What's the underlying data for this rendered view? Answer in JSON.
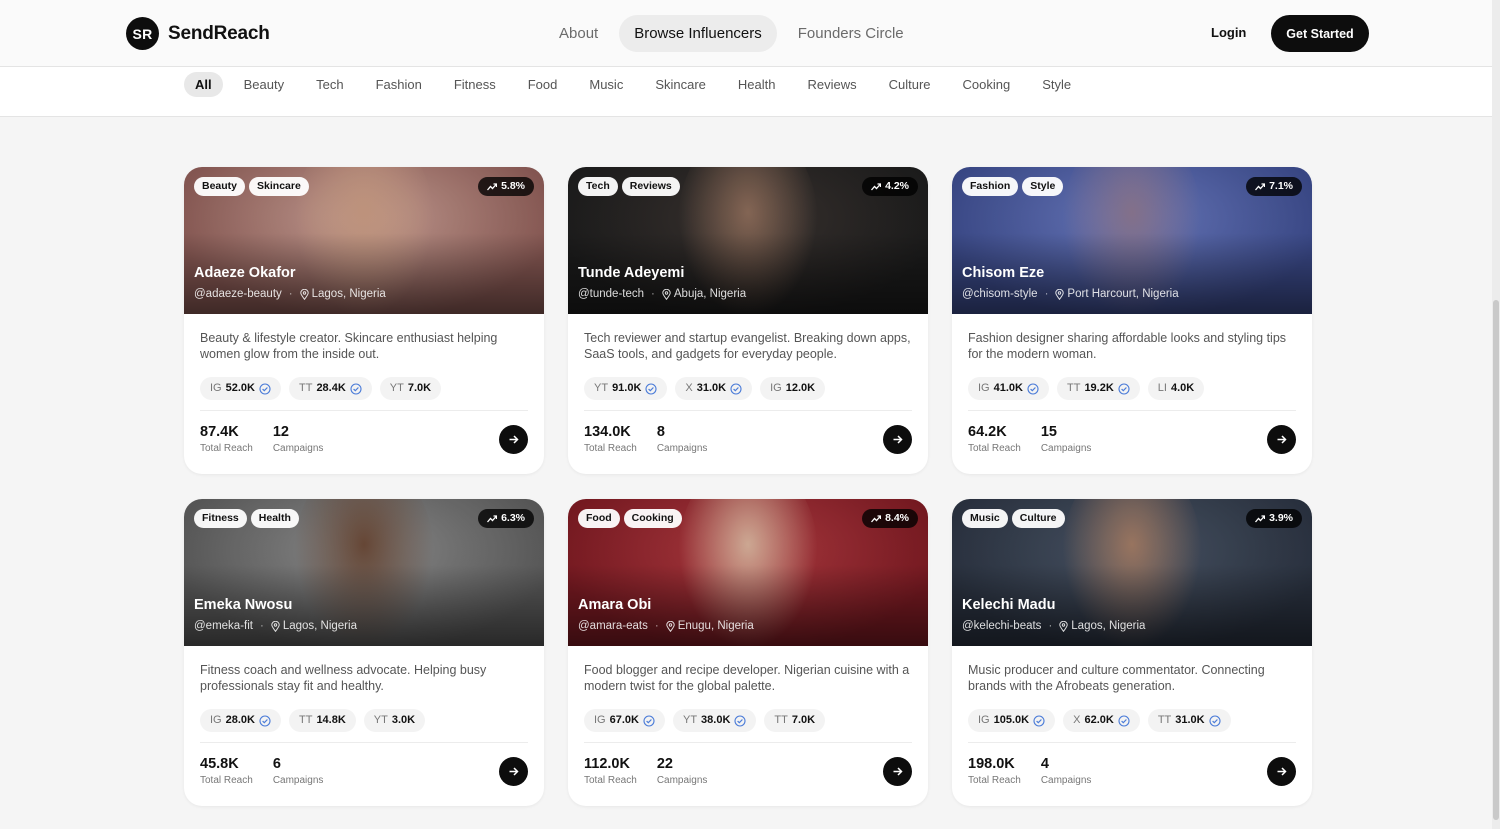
{
  "brand": {
    "mark": "SR",
    "name": "SendReach"
  },
  "nav": {
    "items": [
      {
        "label": "About",
        "active": false
      },
      {
        "label": "Browse Influencers",
        "active": true
      },
      {
        "label": "Founders Circle",
        "active": false
      }
    ],
    "login": "Login",
    "cta": "Get Started"
  },
  "filters": [
    "All",
    "Beauty",
    "Tech",
    "Fashion",
    "Fitness",
    "Food",
    "Music",
    "Skincare",
    "Health",
    "Reviews",
    "Culture",
    "Cooking",
    "Style"
  ],
  "active_filter": "All",
  "labels": {
    "total_reach": "Total Reach",
    "campaigns": "Campaigns"
  },
  "influencers": [
    {
      "tags": [
        "Beauty",
        "Skincare"
      ],
      "growth": "5.8%",
      "name": "Adaeze Okafor",
      "handle": "@adaeze-beauty",
      "location": "Lagos, Nigeria",
      "bio": "Beauty & lifestyle creator. Skincare enthusiast helping women glow from the inside out.",
      "socials": [
        {
          "platform": "IG",
          "count": "52.0K",
          "verified": true
        },
        {
          "platform": "TT",
          "count": "28.4K",
          "verified": true
        },
        {
          "platform": "YT",
          "count": "7.0K",
          "verified": false
        }
      ],
      "reach": "87.4K",
      "campaigns": "12",
      "photo": {
        "bg1": "#8a5a55",
        "bg2": "#c9a095",
        "skin": "#c79a82"
      }
    },
    {
      "tags": [
        "Tech",
        "Reviews"
      ],
      "growth": "4.2%",
      "name": "Tunde Adeyemi",
      "handle": "@tunde-tech",
      "location": "Abuja, Nigeria",
      "bio": "Tech reviewer and startup evangelist. Breaking down apps, SaaS tools, and gadgets for everyday people.",
      "socials": [
        {
          "platform": "YT",
          "count": "91.0K",
          "verified": true
        },
        {
          "platform": "X",
          "count": "31.0K",
          "verified": true
        },
        {
          "platform": "IG",
          "count": "12.0K",
          "verified": false
        }
      ],
      "reach": "134.0K",
      "campaigns": "8",
      "photo": {
        "bg1": "#1c1c1c",
        "bg2": "#3a3330",
        "skin": "#8a6a58"
      }
    },
    {
      "tags": [
        "Fashion",
        "Style"
      ],
      "growth": "7.1%",
      "name": "Chisom Eze",
      "handle": "@chisom-style",
      "location": "Port Harcourt, Nigeria",
      "bio": "Fashion designer sharing affordable looks and styling tips for the modern woman.",
      "socials": [
        {
          "platform": "IG",
          "count": "41.0K",
          "verified": true
        },
        {
          "platform": "TT",
          "count": "19.2K",
          "verified": true
        },
        {
          "platform": "LI",
          "count": "4.0K",
          "verified": false
        }
      ],
      "reach": "64.2K",
      "campaigns": "15",
      "photo": {
        "bg1": "#3b4a8a",
        "bg2": "#6a7ac0",
        "skin": "#8a7690"
      }
    },
    {
      "tags": [
        "Fitness",
        "Health"
      ],
      "growth": "6.3%",
      "name": "Emeka Nwosu",
      "handle": "@emeka-fit",
      "location": "Lagos, Nigeria",
      "bio": "Fitness coach and wellness advocate. Helping busy professionals stay fit and healthy.",
      "socials": [
        {
          "platform": "IG",
          "count": "28.0K",
          "verified": true
        },
        {
          "platform": "TT",
          "count": "14.8K",
          "verified": false
        },
        {
          "platform": "YT",
          "count": "3.0K",
          "verified": false
        }
      ],
      "reach": "45.8K",
      "campaigns": "6",
      "photo": {
        "bg1": "#5a5a5a",
        "bg2": "#8e8e8e",
        "skin": "#6b4a38"
      }
    },
    {
      "tags": [
        "Food",
        "Cooking"
      ],
      "growth": "8.4%",
      "name": "Amara Obi",
      "handle": "@amara-eats",
      "location": "Enugu, Nigeria",
      "bio": "Food blogger and recipe developer. Nigerian cuisine with a modern twist for the global palette.",
      "socials": [
        {
          "platform": "IG",
          "count": "67.0K",
          "verified": true
        },
        {
          "platform": "YT",
          "count": "38.0K",
          "verified": true
        },
        {
          "platform": "TT",
          "count": "7.0K",
          "verified": false
        }
      ],
      "reach": "112.0K",
      "campaigns": "22",
      "photo": {
        "bg1": "#7a1a22",
        "bg2": "#b03a40",
        "skin": "#d7b09a"
      }
    },
    {
      "tags": [
        "Music",
        "Culture"
      ],
      "growth": "3.9%",
      "name": "Kelechi Madu",
      "handle": "@kelechi-beats",
      "location": "Lagos, Nigeria",
      "bio": "Music producer and culture commentator. Connecting brands with the Afrobeats generation.",
      "socials": [
        {
          "platform": "IG",
          "count": "105.0K",
          "verified": true
        },
        {
          "platform": "X",
          "count": "62.0K",
          "verified": true
        },
        {
          "platform": "TT",
          "count": "31.0K",
          "verified": true
        }
      ],
      "reach": "198.0K",
      "campaigns": "4",
      "photo": {
        "bg1": "#2a3240",
        "bg2": "#4a5566",
        "skin": "#a07a64"
      }
    }
  ]
}
